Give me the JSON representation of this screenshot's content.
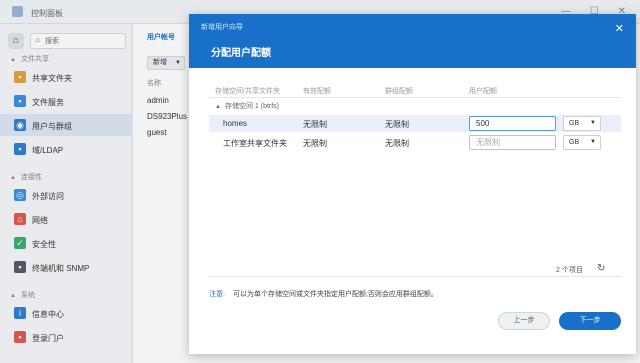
{
  "app": {
    "title": "控制面板",
    "window_controls": "— ☐ ✕"
  },
  "sidebar": {
    "search_placeholder": "搜索",
    "sections": [
      {
        "label": "文件共享"
      },
      {
        "label": "连接性"
      },
      {
        "label": "系统"
      }
    ],
    "items": [
      {
        "label": "共享文件夹",
        "icon": "folder-icon"
      },
      {
        "label": "文件服务",
        "icon": "file-service-icon"
      },
      {
        "label": "用户与群组",
        "icon": "users-icon"
      },
      {
        "label": "域/LDAP",
        "icon": "domain-icon"
      },
      {
        "label": "外部访问",
        "icon": "external-access-icon"
      },
      {
        "label": "网络",
        "icon": "network-icon"
      },
      {
        "label": "安全性",
        "icon": "shield-icon"
      },
      {
        "label": "终端机和 SNMP",
        "icon": "terminal-icon"
      },
      {
        "label": "信息中心",
        "icon": "info-icon"
      },
      {
        "label": "登录门户",
        "icon": "login-portal-icon"
      }
    ]
  },
  "main": {
    "tab": "用户帐号",
    "new_button": "新增",
    "column_name": "名称",
    "users": [
      "admin",
      "DS923Plus",
      "guest"
    ]
  },
  "wizard": {
    "window_title": "新增用户向导",
    "heading": "分配用户配额",
    "columns": [
      "存储空间/共享文件夹",
      "有效配额",
      "群组配额",
      "用户配额"
    ],
    "group": "存储空间 1 (btrfs)",
    "rows": [
      {
        "name": "homes",
        "effective": "无限制",
        "group": "无限制",
        "user_quota": "500",
        "unit": "GB"
      },
      {
        "name": "工作室共享文件夹",
        "effective": "无限制",
        "group": "无限制",
        "user_quota": "无限制",
        "unit": "GB"
      }
    ],
    "count": "2 个项目",
    "note_label": "注意:",
    "note_text": "可以为单个存储空间或文件夹指定用户配额;否则会应用群组配额。",
    "prev_button": "上一步",
    "next_button": "下一步"
  },
  "colors": {
    "accent": "#1970c9",
    "selected_row": "#e8f1fb"
  }
}
